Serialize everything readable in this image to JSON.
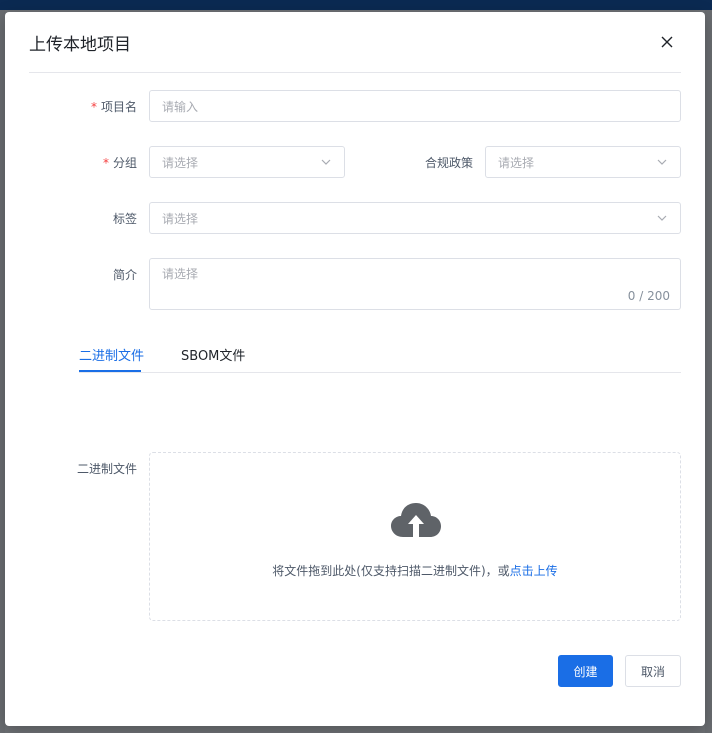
{
  "modal": {
    "title": "上传本地项目",
    "close_icon": "close-icon"
  },
  "form": {
    "project_name": {
      "label": "项目名",
      "required": true,
      "placeholder": "请输入"
    },
    "group": {
      "label": "分组",
      "required": true,
      "placeholder": "请选择"
    },
    "compliance_policy": {
      "label": "合规政策",
      "placeholder": "请选择"
    },
    "tags": {
      "label": "标签",
      "placeholder": "请选择"
    },
    "description": {
      "label": "简介",
      "placeholder": "请选择",
      "counter": "0 / 200"
    }
  },
  "tabs": [
    {
      "label": "二进制文件",
      "active": true
    },
    {
      "label": "SBOM文件",
      "active": false
    }
  ],
  "upload": {
    "label": "二进制文件",
    "icon": "cloud-upload-icon",
    "hint": "将文件拖到此处(仅支持扫描二进制文件)，或",
    "link": "点击上传"
  },
  "actions": {
    "create": "创建",
    "cancel": "取消"
  },
  "colors": {
    "primary": "#1a6ee6",
    "required": "#f53f3f",
    "overlay": "#6e7175"
  }
}
